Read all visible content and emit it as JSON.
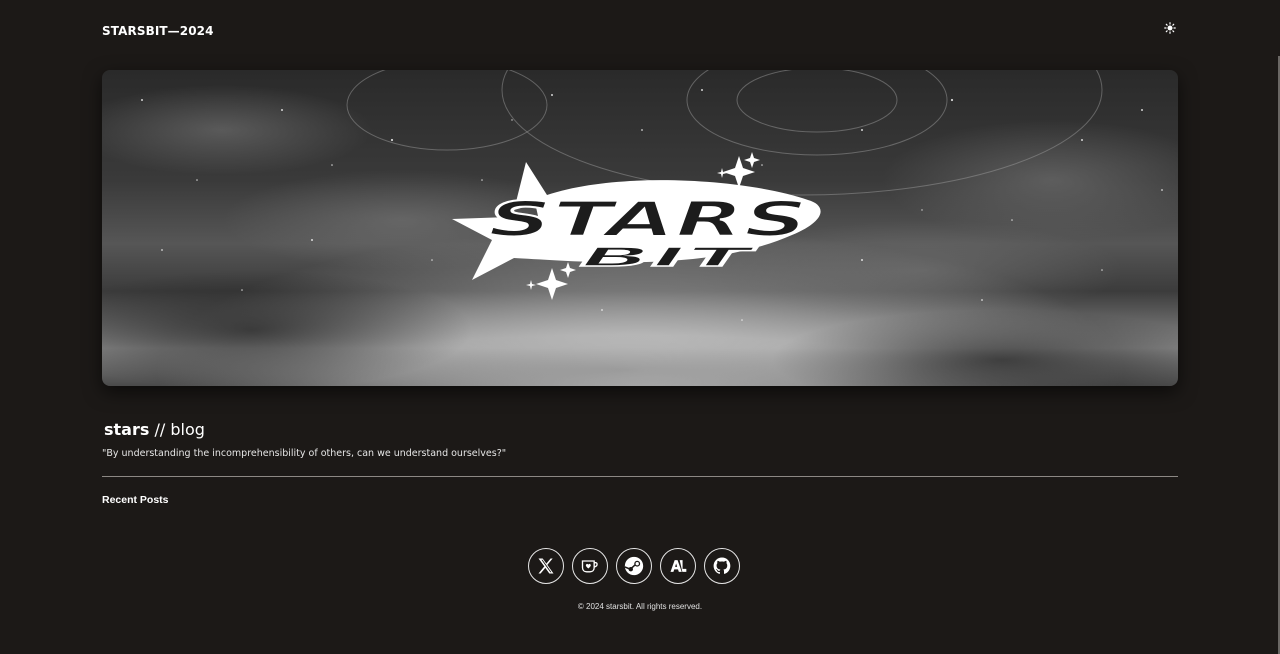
{
  "header": {
    "site_title": "STARSBIT—2024",
    "theme_toggle_icon": "sun-icon"
  },
  "hero": {
    "logo_text_main": "STARS",
    "logo_text_sub": "BIT",
    "background": "night-sky-clouds-grayscale"
  },
  "intro": {
    "title_bold": "stars",
    "title_rest": " // blog",
    "tagline": "\"By understanding the incomprehensibility of others, can we understand ourselves?\""
  },
  "posts": {
    "heading": "Recent Posts"
  },
  "socials": [
    {
      "icon": "x-twitter-icon"
    },
    {
      "icon": "kofi-cup-icon"
    },
    {
      "icon": "steam-icon"
    },
    {
      "icon": "anilist-icon"
    },
    {
      "icon": "github-icon"
    }
  ],
  "footer": {
    "copyright": "© 2024 starsbit. All rights reserved."
  },
  "colors": {
    "background": "#1c1917",
    "text": "#ffffff",
    "divider": "#8c8884"
  }
}
